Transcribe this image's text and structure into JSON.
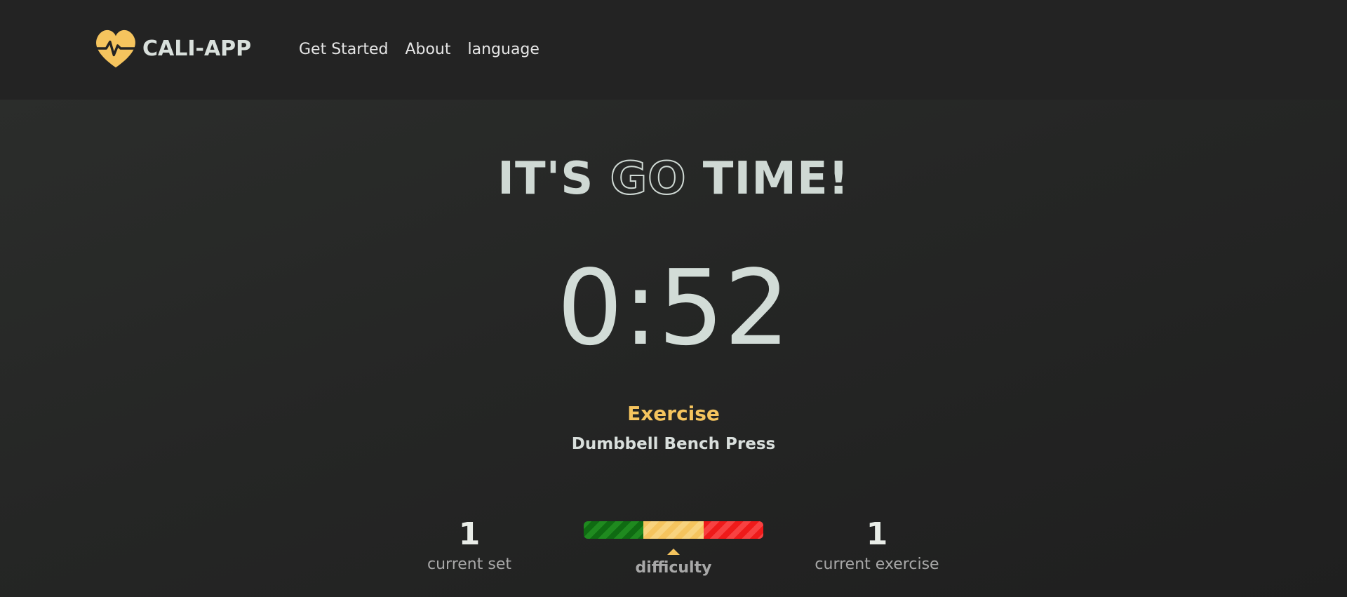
{
  "nav": {
    "brand": "CALI-APP",
    "links": [
      "Get Started",
      "About",
      "language"
    ]
  },
  "hero": {
    "headline_part1": "IT'S ",
    "headline_outline": "GO",
    "headline_part2": " TIME!",
    "timer": "0:52",
    "exercise_label": "Exercise",
    "exercise_name": "Dumbbell Bench Press"
  },
  "stats": {
    "current_set_value": "1",
    "current_set_label": "current set",
    "difficulty_label": "difficulty",
    "difficulty_level": "medium",
    "current_exercise_value": "1",
    "current_exercise_label": "current exercise"
  },
  "colors": {
    "accent": "#f5c45e",
    "background": "#232323",
    "text": "#d2dcd7",
    "easy": "#1f8a1f",
    "hard": "#ef1a1a"
  }
}
